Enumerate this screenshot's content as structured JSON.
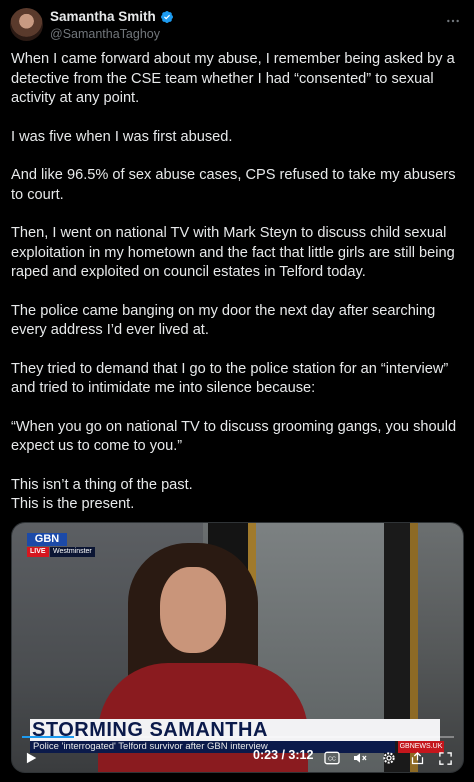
{
  "author": {
    "name": "Samantha Smith",
    "handle": "@SamanthaTaghoy",
    "verified": true
  },
  "post": {
    "paragraphs": [
      "When I came forward about my abuse, I remember being asked by a detective from the CSE team whether I had “consented” to sexual activity at any point.",
      "I was five when I was first abused.",
      "And like 96.5% of sex abuse cases, CPS refused to take my abusers to court.",
      "Then, I went on national TV with Mark Steyn to discuss child sexual exploitation in my hometown and the fact that little girls are still being raped and exploited on council estates in Telford today.",
      "The police came banging on my door the next day after searching every address I’d ever lived at.",
      "They tried to demand that I go to the police station for an “interview” and tried to intimidate me into silence because:",
      "“When you go on national TV to discuss grooming gangs, you should expect us to come to you.”",
      "This isn’t a thing of the past.\nThis is the present."
    ]
  },
  "video": {
    "channel_logo": "GBN",
    "live_label": "LIVE",
    "location_label": "Westminster",
    "headline": "STORMING SAMANTHA",
    "subline": "Police 'interrogated' Telford survivor after GBN interview",
    "web_badge": "GBNEWS.UK",
    "time_display": "0:23 / 3:12",
    "progress": 0.12
  },
  "icons": {
    "verified": "verified-badge-icon",
    "more": "more-icon",
    "play": "play-icon",
    "captions": "captions-icon",
    "mute": "mute-icon",
    "settings": "settings-icon",
    "share": "share-icon",
    "fullscreen": "fullscreen-icon"
  },
  "colors": {
    "background": "#000000",
    "text": "#e7e9ea",
    "muted": "#71767b",
    "accent": "#1d9bf0"
  }
}
